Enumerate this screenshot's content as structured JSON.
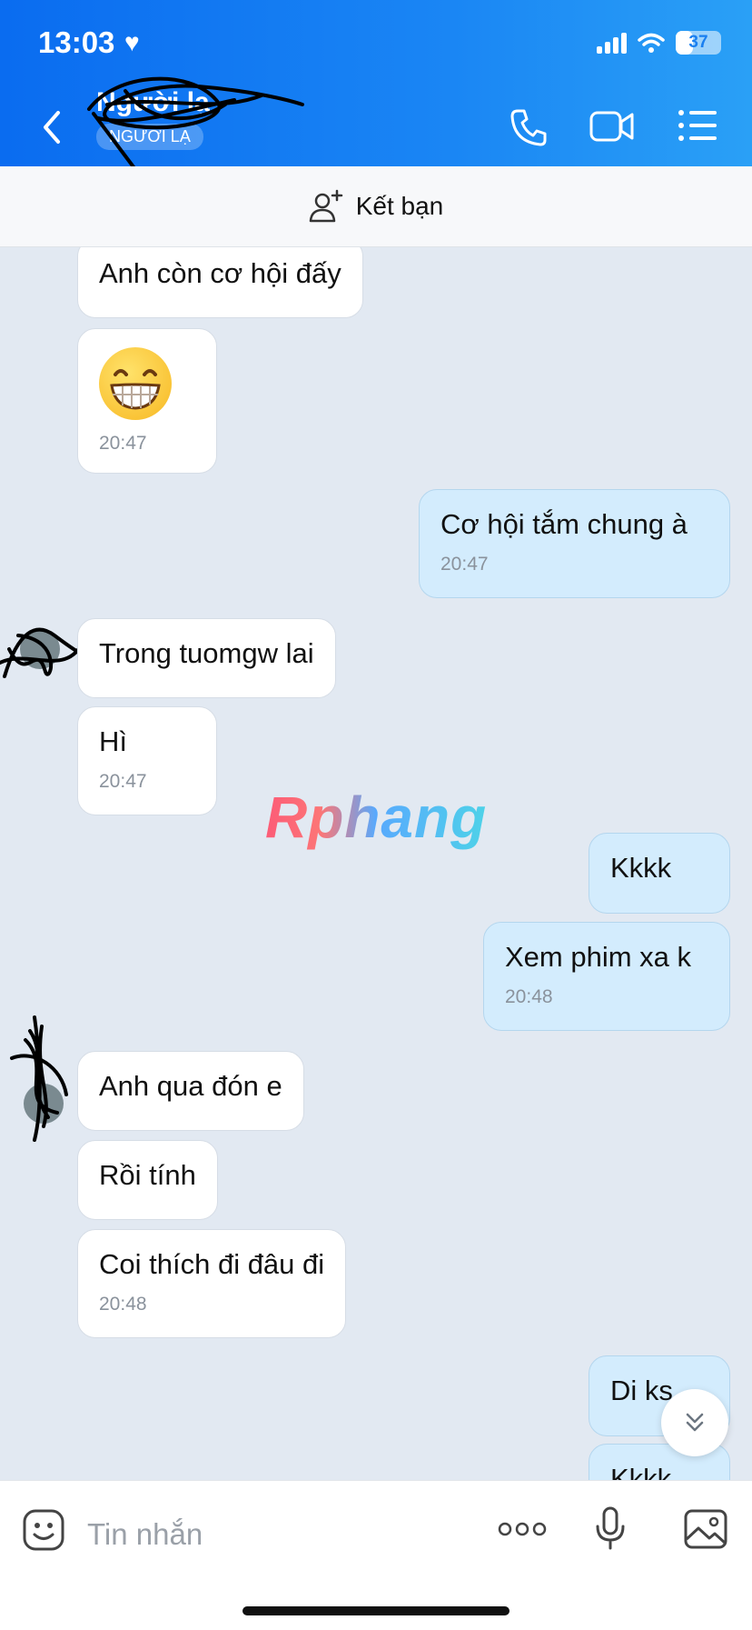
{
  "status": {
    "time": "13:03",
    "battery": "37",
    "battery_level": 0.37
  },
  "header": {
    "contact_name": "Người lạ",
    "contact_tag": "NGƯỜI LẠ"
  },
  "friend_bar": {
    "label": "Kết bạn"
  },
  "messages": [
    {
      "text": "Anh còn cơ hội đấy",
      "time": ""
    },
    {
      "text": "",
      "time": "20:47",
      "emoji": "grinning-face"
    },
    {
      "text": "Cơ hội tắm chung à",
      "time": "20:47"
    },
    {
      "text": "Trong tuomgw lai",
      "time": ""
    },
    {
      "text": "Hì",
      "time": "20:47"
    },
    {
      "text": "Kkkk",
      "time": ""
    },
    {
      "text": "Xem phim xa k",
      "time": "20:48"
    },
    {
      "text": "Anh qua đón e",
      "time": ""
    },
    {
      "text": "Rồi tính",
      "time": ""
    },
    {
      "text": "Coi thích đi đâu đi",
      "time": "20:48"
    },
    {
      "text": "Di ks",
      "time": ""
    },
    {
      "text": "Kkkk",
      "time": ""
    }
  ],
  "watermark": "Rphang",
  "input": {
    "placeholder": "Tin nhắn"
  },
  "colors": {
    "header": "#1a7ff0",
    "mine_bubble": "#d3ecfd",
    "chat_bg": "#e2e9f2"
  }
}
